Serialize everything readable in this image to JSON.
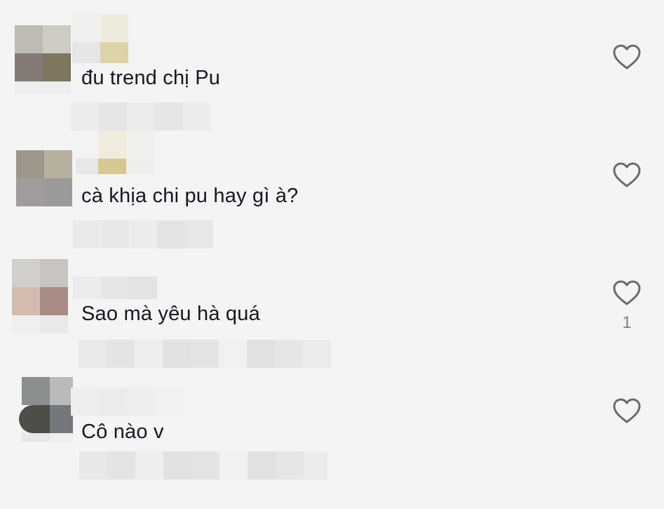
{
  "comments": [
    {
      "text": "đu trend chị Pu",
      "likes": "",
      "like_icon": "heart-outline-icon"
    },
    {
      "text": "cà khịa chi pu hay gì à?",
      "likes": "",
      "like_icon": "heart-outline-icon"
    },
    {
      "text": "Sao mà yêu hà quá",
      "likes": "1",
      "like_icon": "heart-outline-icon"
    },
    {
      "text": "Cô nào v",
      "likes": "",
      "like_icon": "heart-outline-icon"
    }
  ],
  "colors": {
    "background": "#f4f4f4",
    "text": "#161823",
    "icon": "#6b6b6b",
    "count": "#7f7f7f"
  }
}
